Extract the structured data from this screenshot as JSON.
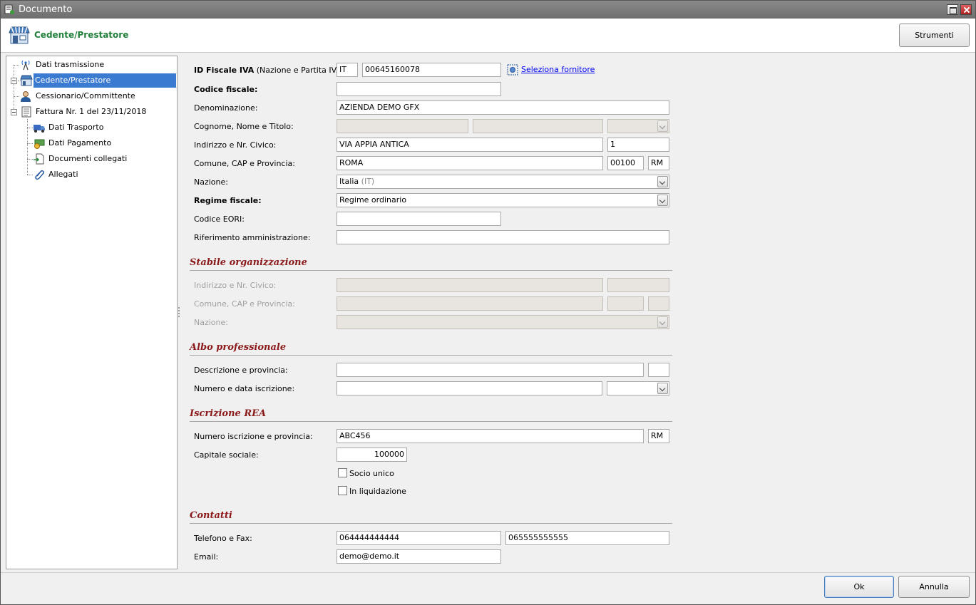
{
  "window": {
    "title": "Documento"
  },
  "header": {
    "title": "Cedente/Prestatore",
    "tools_button": "Strumenti"
  },
  "tree": {
    "items": [
      {
        "label": "Dati trasmissione",
        "icon": "antenna-icon"
      },
      {
        "label": "Cedente/Prestatore",
        "icon": "store-icon",
        "selected": true
      },
      {
        "label": "Cessionario/Committente",
        "icon": "user-icon"
      },
      {
        "label": "Fattura Nr. 1 del 23/11/2018",
        "icon": "document-icon"
      },
      {
        "label": "Dati Trasporto",
        "icon": "truck-icon"
      },
      {
        "label": "Dati Pagamento",
        "icon": "payment-icon"
      },
      {
        "label": "Documenti collegati",
        "icon": "linked-document-icon"
      },
      {
        "label": "Allegati",
        "icon": "paperclip-icon"
      }
    ]
  },
  "form": {
    "id_fiscale": {
      "label": "ID Fiscale IVA",
      "sublabel": " (Nazione e Partita IVA):",
      "country": "IT",
      "vat": "00645160078",
      "select_link": "Seleziona fornitore"
    },
    "codice_fiscale": {
      "label": "Codice fiscale:",
      "value": ""
    },
    "denominazione": {
      "label": "Denominazione:",
      "value": "AZIENDA DEMO GFX"
    },
    "cognome_nome": {
      "label": "Cognome, Nome e Titolo:"
    },
    "indirizzo": {
      "label": "Indirizzo e Nr. Civico:",
      "street": "VIA APPIA ANTICA",
      "number": "1"
    },
    "comune": {
      "label": "Comune, CAP e Provincia:",
      "city": "ROMA",
      "cap": "00100",
      "province": "RM"
    },
    "nazione": {
      "label": "Nazione:",
      "value": "Italia",
      "code": "(IT)"
    },
    "regime": {
      "label": "Regime fiscale:",
      "value": "Regime ordinario"
    },
    "eori": {
      "label": "Codice EORI:",
      "value": ""
    },
    "rif_amm": {
      "label": "Riferimento amministrazione:",
      "value": ""
    }
  },
  "stabile": {
    "title": "Stabile organizzazione",
    "indirizzo_label": "Indirizzo e Nr. Civico:",
    "comune_label": "Comune, CAP e Provincia:",
    "nazione_label": "Nazione:"
  },
  "albo": {
    "title": "Albo professionale",
    "descrizione_label": "Descrizione e provincia:",
    "numero_label": "Numero e data iscrizione:"
  },
  "rea": {
    "title": "Iscrizione REA",
    "numero_label": "Numero iscrizione e provincia:",
    "numero": "ABC456",
    "provincia": "RM",
    "capitale_label": "Capitale sociale:",
    "capitale": "100000",
    "socio_unico": "Socio unico",
    "liquidazione": "In liquidazione"
  },
  "contatti": {
    "title": "Contatti",
    "telefono_label": "Telefono e Fax:",
    "telefono": "064444444444",
    "fax": "065555555555",
    "email_label": "Email:",
    "email": "demo@demo.it"
  },
  "footer": {
    "ok": "Ok",
    "cancel": "Annulla"
  }
}
